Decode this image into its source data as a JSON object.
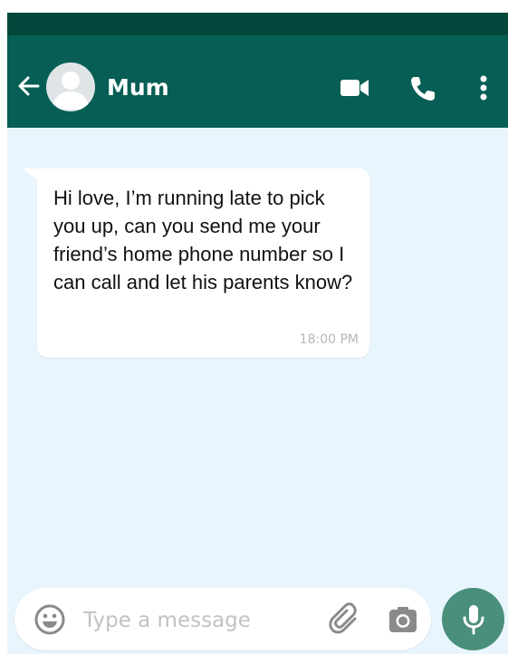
{
  "header": {
    "contact_name": "Mum",
    "icons": {
      "back": "arrow-left-icon",
      "avatar": "default-avatar-icon",
      "video": "video-camera-icon",
      "call": "phone-icon",
      "menu": "more-vertical-icon"
    }
  },
  "conversation": {
    "messages": [
      {
        "direction": "incoming",
        "text": "Hi love, I’m running late to pick you up, can you send me your friend’s home phone number so I can call and let his parents know?",
        "time": "18:00 PM"
      }
    ]
  },
  "composer": {
    "placeholder": "Type a message",
    "icons": {
      "emoji": "emoji-icon",
      "attach": "paperclip-icon",
      "camera": "camera-icon",
      "mic": "microphone-icon"
    }
  },
  "colors": {
    "status_bar": "#03483c",
    "header": "#075e54",
    "chat_background": "#e9f5fd",
    "bubble": "#ffffff",
    "mic_button": "#4a8f7b",
    "timestamp": "#b7b7b7"
  }
}
